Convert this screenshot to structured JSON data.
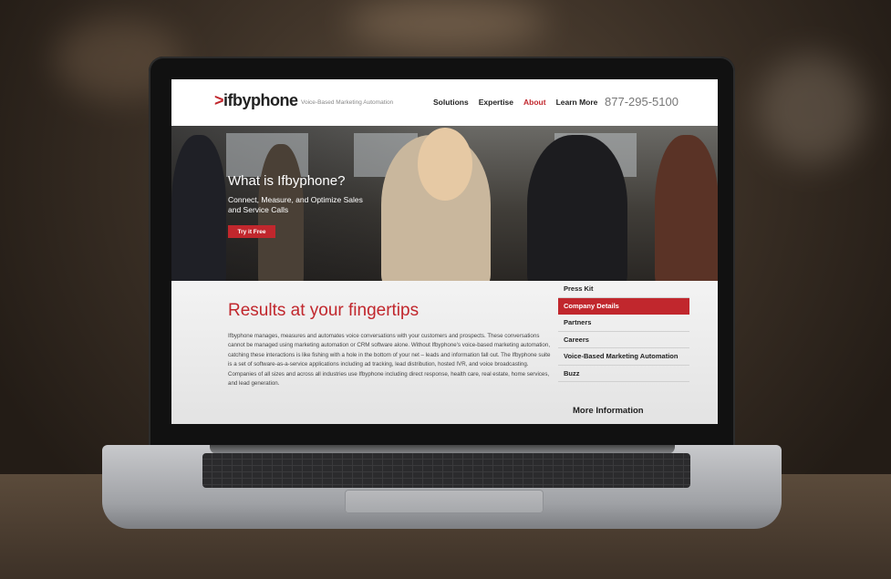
{
  "site": {
    "logo_prefix": ">",
    "logo_text": "ifbyphone",
    "tagline": "Voice-Based Marketing Automation",
    "phone": "877-295-5100",
    "accent_color": "#c1272d"
  },
  "nav": {
    "items": [
      {
        "label": "Solutions",
        "active": false
      },
      {
        "label": "Expertise",
        "active": false
      },
      {
        "label": "About",
        "active": true
      },
      {
        "label": "Learn More",
        "active": false
      }
    ]
  },
  "hero": {
    "title": "What is Ifbyphone?",
    "subtitle": "Connect, Measure, and Optimize Sales and Service Calls",
    "cta_label": "Try it Free"
  },
  "main": {
    "title": "Results at your fingertips",
    "body": "Ifbyphone manages, measures and automates voice conversations with your customers and prospects. These conversations cannot be managed using marketing automation or CRM software alone. Without Ifbyphone's voice-based marketing automation, catching these interactions is like fishing with a hole in the bottom of your net – leads and information fall out. The Ifbyphone suite is a set of software-as-a-service applications including ad tracking, lead distribution, hosted IVR, and voice broadcasting. Companies of all sizes and across all industries use Ifbyphone including direct response, health care, real estate, home services, and lead generation."
  },
  "sidebar": {
    "items": [
      {
        "label": "Press Kit",
        "active": false
      },
      {
        "label": "Company Details",
        "active": true
      },
      {
        "label": "Partners",
        "active": false
      },
      {
        "label": "Careers",
        "active": false
      },
      {
        "label": "Voice-Based Marketing Automation",
        "active": false
      },
      {
        "label": "Buzz",
        "active": false
      }
    ],
    "more_info_label": "More Information"
  }
}
